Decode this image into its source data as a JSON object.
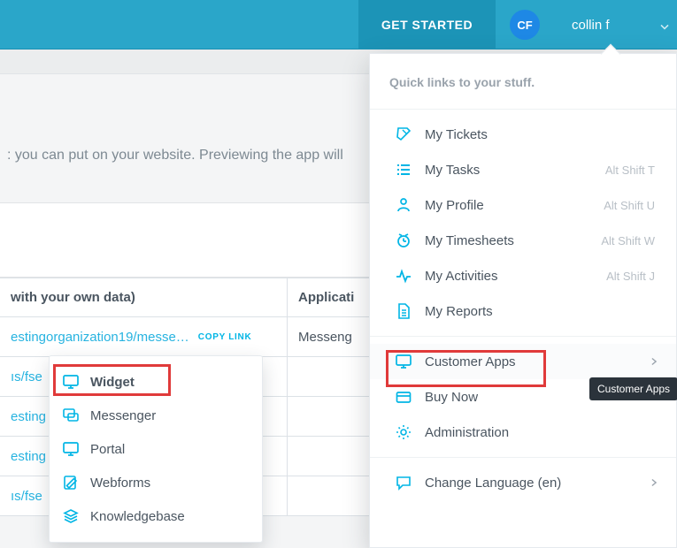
{
  "header": {
    "get_started": "GET STARTED",
    "avatar_initials": "CF",
    "username": "collin f"
  },
  "description": ": you can put on your website. Previewing the app will",
  "table": {
    "col1": "with your own data)",
    "col2": "Applicati",
    "rows": [
      {
        "url": "estingorganization19/messe…",
        "copy": "COPY LINK",
        "app": "Messeng"
      },
      {
        "url": "ıs/fse",
        "copy": "",
        "app": ""
      },
      {
        "url": "esting",
        "copy": "",
        "app": ""
      },
      {
        "url": "esting",
        "copy": "",
        "app": ""
      },
      {
        "url": "ıs/fse",
        "copy": "",
        "app": ""
      }
    ]
  },
  "apps_popup": [
    {
      "name": "widget",
      "label": "Widget",
      "icon": "monitor"
    },
    {
      "name": "messenger",
      "label": "Messenger",
      "icon": "chat"
    },
    {
      "name": "portal",
      "label": "Portal",
      "icon": "monitor"
    },
    {
      "name": "webforms",
      "label": "Webforms",
      "icon": "edit"
    },
    {
      "name": "knowledgebase",
      "label": "Knowledgebase",
      "icon": "stack"
    }
  ],
  "dropdown": {
    "header": "Quick links to your stuff.",
    "items": [
      {
        "name": "my-tickets",
        "label": "My Tickets",
        "icon": "ticket"
      },
      {
        "name": "my-tasks",
        "label": "My Tasks",
        "icon": "list",
        "kbd": "Alt Shift T"
      },
      {
        "name": "my-profile",
        "label": "My Profile",
        "icon": "person",
        "kbd": "Alt Shift U"
      },
      {
        "name": "my-timesheets",
        "label": "My Timesheets",
        "icon": "clock",
        "kbd": "Alt Shift W"
      },
      {
        "name": "my-activities",
        "label": "My Activities",
        "icon": "pulse",
        "kbd": "Alt Shift J"
      },
      {
        "name": "my-reports",
        "label": "My Reports",
        "icon": "doc"
      }
    ],
    "items2": [
      {
        "name": "customer-apps",
        "label": "Customer Apps",
        "icon": "monitor",
        "chevron": true,
        "hover": true
      },
      {
        "name": "buy-now",
        "label": "Buy Now",
        "icon": "card"
      },
      {
        "name": "administration",
        "label": "Administration",
        "icon": "gear"
      }
    ],
    "items3": [
      {
        "name": "change-language",
        "label": "Change Language (en)",
        "icon": "speech",
        "chevron": true
      }
    ]
  },
  "tooltip": "Customer Apps"
}
